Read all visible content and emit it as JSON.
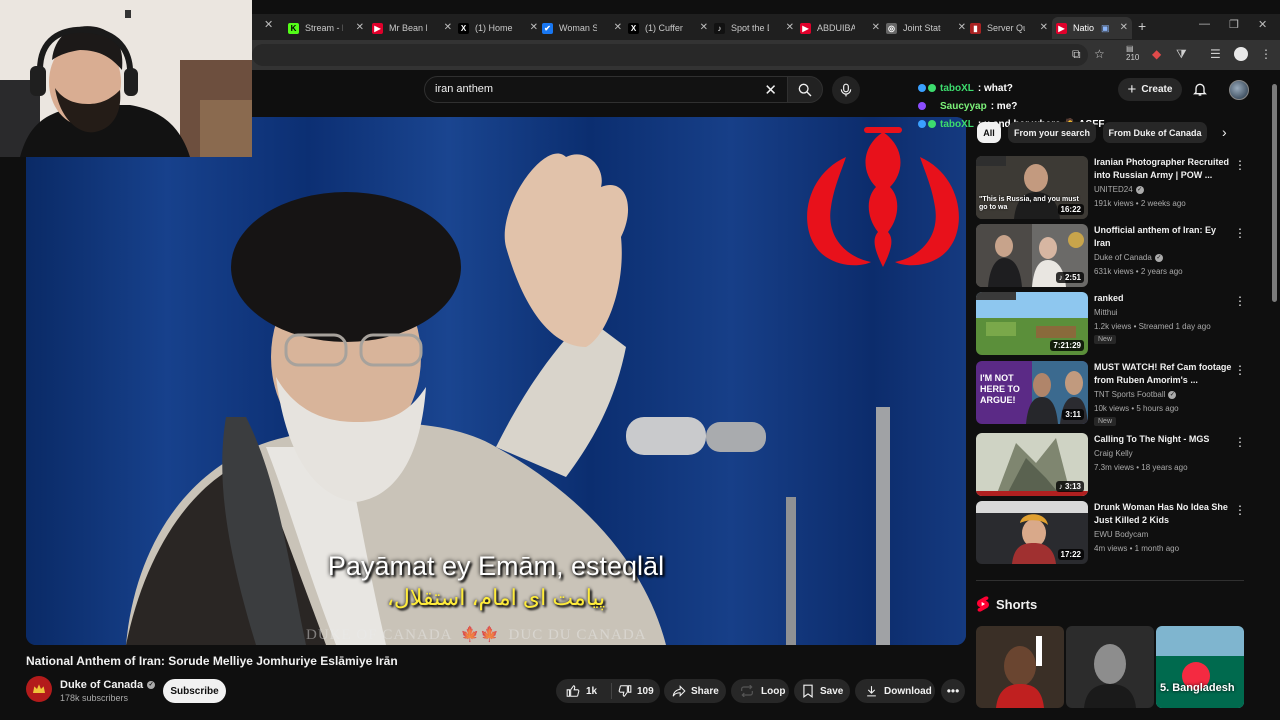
{
  "browser": {
    "tabs": [
      {
        "title": "Stream - K",
        "fav": "K",
        "favColor": "#53fc18"
      },
      {
        "title": "Mr Bean M",
        "fav": "▶",
        "favColor": "#e0002b"
      },
      {
        "title": "(1) Home /",
        "fav": "X",
        "favColor": "#000000"
      },
      {
        "title": "Woman Sh",
        "fav": "✔",
        "favColor": "#1877f2"
      },
      {
        "title": "(1) Cuffem",
        "fav": "X",
        "favColor": "#000000"
      },
      {
        "title": "Spot the D",
        "fav": "♪",
        "favColor": "#111111"
      },
      {
        "title": "ABDUIBAR",
        "fav": "▶",
        "favColor": "#e0002b"
      },
      {
        "title": "Joint State",
        "fav": "◎",
        "favColor": "#666666"
      },
      {
        "title": "Server Qu",
        "fav": "▮",
        "favColor": "#aa2222"
      },
      {
        "title": "Natio",
        "fav": "▶",
        "favColor": "#e0002b"
      }
    ],
    "toolbar_badge": "210"
  },
  "search": {
    "query": "iran anthem"
  },
  "header": {
    "create_label": "Create"
  },
  "chat": [
    {
      "user": "taboXL",
      "userColor": "#3ddc6e",
      "msg": ": what?"
    },
    {
      "user": "Saucyyap",
      "userColor": "#7cf27a",
      "msg": ": me?"
    },
    {
      "user": "taboXL",
      "userColor": "#3ddc6e",
      "msg": ": u and her where 🤷 ASFF"
    }
  ],
  "video": {
    "subtitle_latin": "Payāmat ey Emām, esteqlāl",
    "subtitle_persian": "پیامت ای امام، استقلال،",
    "watermark_left": "DUKE OF CANADA",
    "watermark_right": "DUC DU CANADA",
    "title": "National Anthem of Iran: Sorude Melliye Jomhuriye Eslāmiye Irān",
    "channel": "Duke of Canada",
    "subscribers": "178k subscribers",
    "subscribe_label": "Subscribe",
    "likes": "1k",
    "dislikes": "109",
    "share_label": "Share",
    "loop_label": "Loop",
    "save_label": "Save",
    "download_label": "Download"
  },
  "chips": [
    "All",
    "From your search",
    "From Duke of Canada"
  ],
  "recommendations": [
    {
      "title": "Iranian Photographer Recruited into Russian Army | POW ...",
      "channel": "UNITED24",
      "verified": true,
      "meta": "191k views • 2 weeks ago",
      "duration": "16:22",
      "badge": "",
      "thumb_caption": "\"This is Russia, and you must go to wa"
    },
    {
      "title": "Unofficial anthem of Iran: Ey Iran",
      "channel": "Duke of Canada",
      "verified": true,
      "meta": "631k views • 2 years ago",
      "duration": "2:51",
      "badge": "",
      "thumb_caption": ""
    },
    {
      "title": "ranked",
      "channel": "Mitthui",
      "verified": false,
      "meta": "1.2k views • Streamed 1 day ago",
      "duration": "7:21:29",
      "badge": "New",
      "thumb_caption": ""
    },
    {
      "title": "MUST WATCH! Ref Cam footage from Ruben Amorim's ...",
      "channel": "TNT Sports Football",
      "verified": true,
      "meta": "10k views • 5 hours ago",
      "duration": "3:11",
      "badge": "New",
      "thumb_caption": "I'M NOT HERE TO ARGUE!"
    },
    {
      "title": "Calling To The Night - MGS",
      "channel": "Craig Kelly",
      "verified": false,
      "meta": "7.3m views • 18 years ago",
      "duration": "3:13",
      "badge": "",
      "thumb_caption": ""
    },
    {
      "title": "Drunk Woman Has No Idea She Just Killed 2 Kids",
      "channel": "EWU Bodycam",
      "verified": false,
      "meta": "4m views • 1 month ago",
      "duration": "17:22",
      "badge": "",
      "thumb_caption": ""
    }
  ],
  "shorts": {
    "label": "Shorts",
    "items": [
      {
        "caption": ""
      },
      {
        "caption": ""
      },
      {
        "caption": "5. Bangladesh"
      }
    ]
  },
  "colors": {
    "yt_red": "#ff0033",
    "emblem_red": "#e8111b",
    "video_blue": "#0c2d6a"
  }
}
